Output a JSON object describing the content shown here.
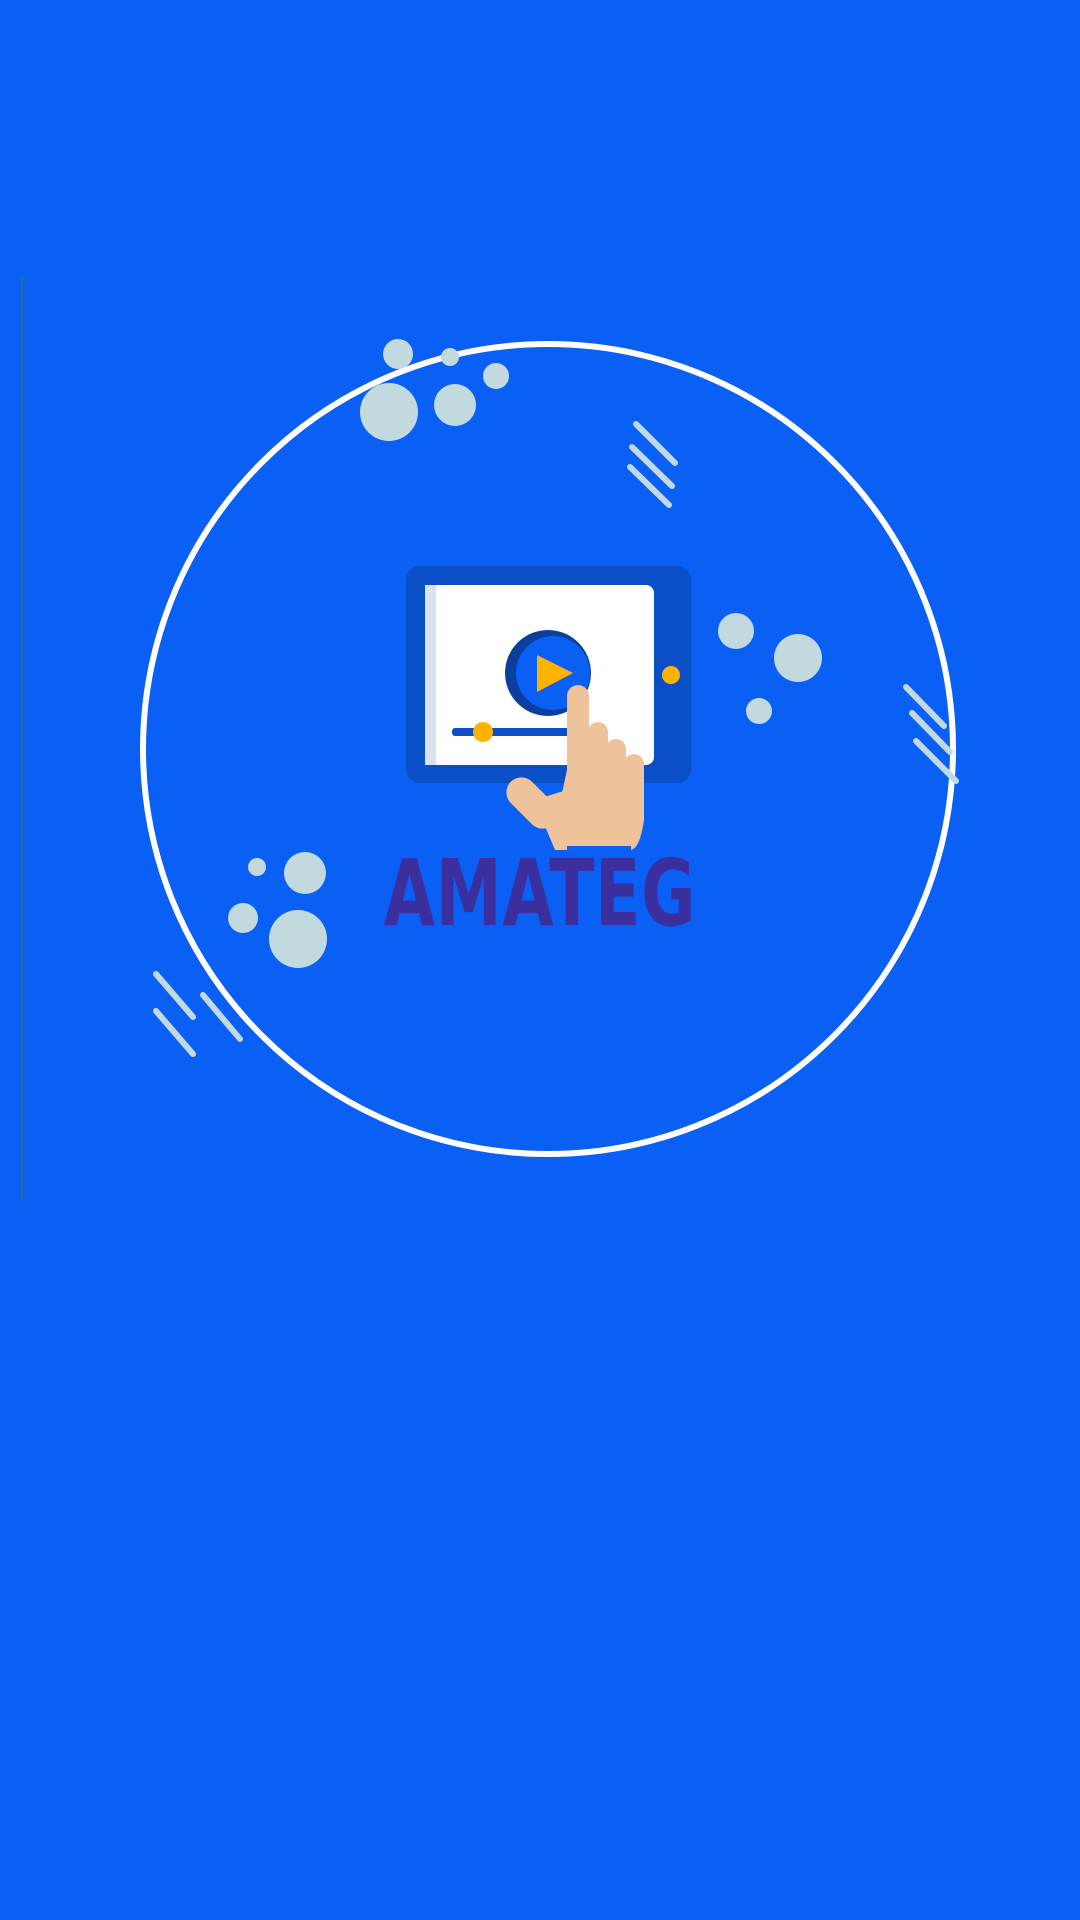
{
  "splash": {
    "brand_name": "AMATEG",
    "icon": "video-play-touch-icon"
  },
  "colors": {
    "background": "#0a5ff5",
    "brand_text": "#3a2f9c",
    "ring": "#ffffff",
    "decoration": "#c2d9e0",
    "tablet": "#0a4fc6",
    "accent": "#ffb300",
    "hand": "#efc39a"
  }
}
